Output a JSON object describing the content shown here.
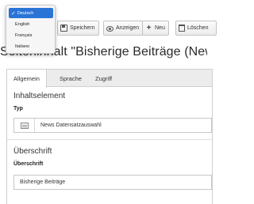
{
  "toolbar": {
    "buttons": [
      {
        "label": "Speichern",
        "icon": "save-icon"
      },
      {
        "label": "Anzeigen",
        "icon": "view-icon"
      },
      {
        "label": "Neu",
        "icon": "plus-icon"
      },
      {
        "label": "Löschen",
        "icon": "trash-icon"
      }
    ]
  },
  "page": {
    "title": "Seiteninhalt \"Bisherige Beiträge (News"
  },
  "tabs": [
    "Allgemein",
    "Sprache",
    "Zugriff"
  ],
  "sections": {
    "content": {
      "heading": "Inhaltselement",
      "type_label": "Typ",
      "type_value": "News Datensatzauswahl"
    },
    "header": {
      "heading": "Überschrift",
      "field_label": "Überschrift",
      "field_value": "Bisherige Beiträge"
    }
  },
  "language_menu": {
    "selected": "Deutsch",
    "options": [
      "Deutsch",
      "English",
      "Français",
      "Italiano"
    ],
    "accent_color": "#2a74d6"
  }
}
